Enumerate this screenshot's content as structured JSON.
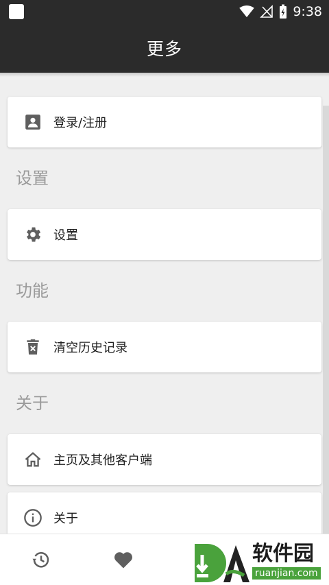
{
  "status": {
    "time": "9:38"
  },
  "appbar": {
    "title": "更多"
  },
  "login": {
    "label": "登录/注册",
    "icon": "account-box-icon"
  },
  "sections": [
    {
      "title": "设置"
    },
    {
      "title": "功能"
    },
    {
      "title": "关于"
    }
  ],
  "settings": {
    "label": "设置",
    "icon": "gear-icon"
  },
  "clear_history": {
    "label": "清空历史记录",
    "icon": "delete-icon"
  },
  "homepage": {
    "label": "主页及其他客户端",
    "icon": "home-icon"
  },
  "about": {
    "label": "关于",
    "icon": "info-icon"
  },
  "bottomnav": {
    "items": [
      {
        "icon": "history-icon"
      },
      {
        "icon": "heart-icon"
      }
    ]
  },
  "watermark": {
    "brand": "软件园",
    "url": "ruanjian.com",
    "accent": "#4aa23c"
  },
  "colors": {
    "appbar": "#2b2b2b",
    "background": "#efefef",
    "icon": "#5f5f5f"
  }
}
